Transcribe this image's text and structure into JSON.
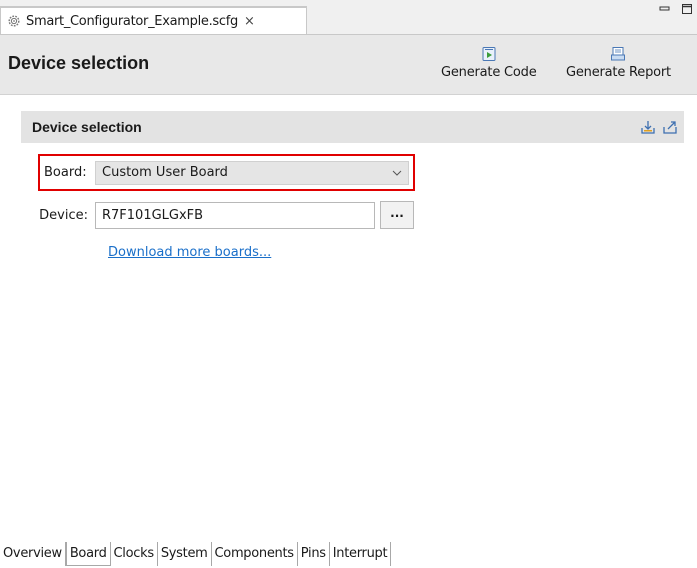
{
  "editor_tab": {
    "title": "Smart_Configurator_Example.scfg",
    "close": "×"
  },
  "window_controls": {
    "minimize": "▭",
    "maximize": "□"
  },
  "header": {
    "title": "Device selection",
    "generate_code": "Generate Code",
    "generate_report": "Generate Report"
  },
  "section": {
    "title": "Device selection"
  },
  "form": {
    "board_label": "Board:",
    "board_value": "Custom User Board",
    "device_label": "Device:",
    "device_value": "R7F101GLGxFB",
    "browse_label": "...",
    "download_link": "Download more boards..."
  },
  "bottom_tabs": [
    "Overview",
    "Board",
    "Clocks",
    "System",
    "Components",
    "Pins",
    "Interrupt"
  ],
  "active_bottom_tab": "Board",
  "colors": {
    "highlight_border": "#e00000",
    "link": "#1a6fc9",
    "header_bg": "#e8e8e8"
  }
}
